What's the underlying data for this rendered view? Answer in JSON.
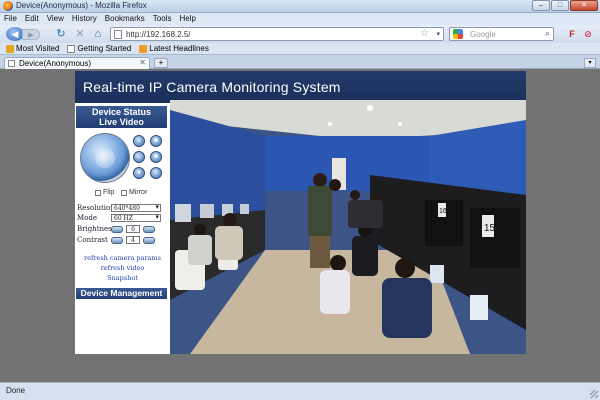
{
  "window": {
    "title": "Device(Anonymous) - Mozilla Firefox",
    "min": "–",
    "max": "□",
    "close": "✕"
  },
  "menu": [
    "File",
    "Edit",
    "View",
    "History",
    "Bookmarks",
    "Tools",
    "Help"
  ],
  "navbar": {
    "url": "http://192.168.2.5/",
    "search_placeholder": "Google"
  },
  "bookmarks": [
    "Most Visited",
    "Getting Started",
    "Latest Headlines"
  ],
  "tab": {
    "label": "Device(Anonymous)"
  },
  "page": {
    "header": "Real-time IP Camera Monitoring System",
    "device_status": "Device Status",
    "live_video": "Live Video",
    "flip_label": "Flip",
    "mirror_label": "Mirror",
    "resolution_label": "Resolution",
    "resolution_value": "640*480",
    "mode_label": "Mode",
    "mode_value": "60 HZ",
    "brightness_label": "Brightness",
    "brightness_value": "6",
    "contrast_label": "Contrast",
    "contrast_value": "4",
    "links": [
      "refresh camera params",
      "refresh video",
      "Snapshot"
    ],
    "device_management": "Device Management"
  },
  "video_scene": {
    "sign_number": "15",
    "sign_number_2": "16"
  },
  "statusbar": {
    "text": "Done"
  }
}
